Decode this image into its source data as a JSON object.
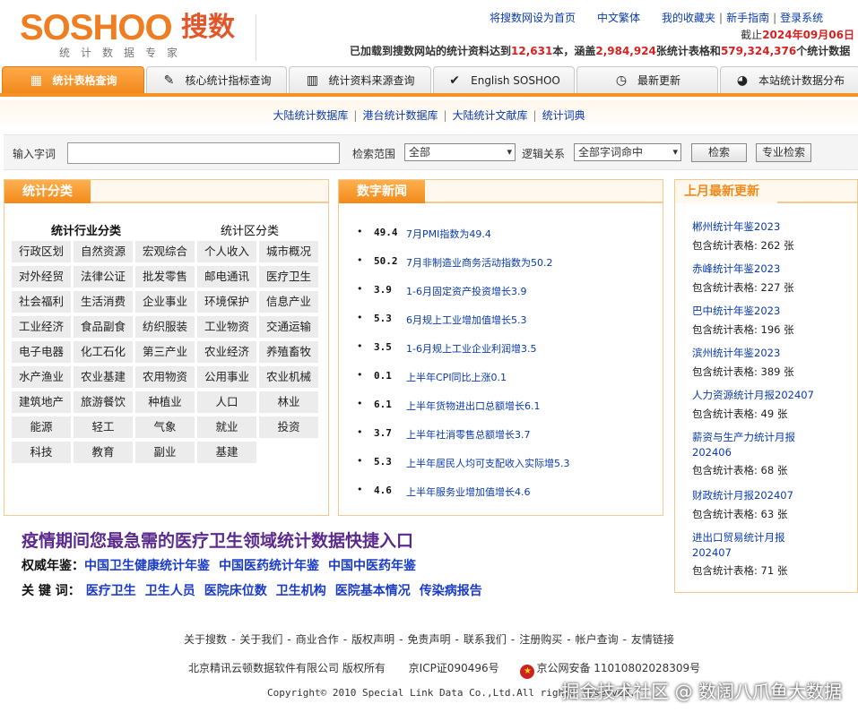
{
  "logo": {
    "brand": "SOSHOO",
    "brand_cn": "搜数",
    "tagline": "统计数据专家"
  },
  "toplinks": [
    "将搜数网设为首页",
    "中文繁体",
    "我的收藏夹",
    "新手指南",
    "登录系统"
  ],
  "date": {
    "prefix": "截止",
    "value": "2024年09月06日"
  },
  "stats": {
    "p1": "已加载到搜数网站的统计资料达到",
    "books": "12,631",
    "p2": "本，涵盖",
    "tables": "2,984,924",
    "p3": "张统计表格和",
    "items": "579,324,376",
    "p4": "个统计数据"
  },
  "tabs": [
    {
      "label": "统计表格查询",
      "icon": "table-icon",
      "glyph": "▦"
    },
    {
      "label": "核心统计指标查询",
      "icon": "document-icon",
      "glyph": "✎"
    },
    {
      "label": "统计资料来源查询",
      "icon": "bar-chart-icon",
      "glyph": "▥"
    },
    {
      "label": "English SOSHOO",
      "icon": "checkmark-icon",
      "glyph": "✔"
    },
    {
      "label": "最新更新",
      "icon": "clock-icon",
      "glyph": "◷"
    },
    {
      "label": "本站统计数据分布",
      "icon": "pie-chart-icon",
      "glyph": "◕"
    }
  ],
  "subnav": [
    "大陆统计数据库",
    "港台统计数据库",
    "大陆统计文献库",
    "统计词典"
  ],
  "search": {
    "keyword_label": "输入字词",
    "scope_label": "检索范围",
    "scope_value": "全部",
    "logic_label": "逻辑关系",
    "logic_value": "全部字词命中",
    "search_button": "检索",
    "advanced_button": "专业检索"
  },
  "categories": {
    "title": "统计分类",
    "industry_head": "统计行业分类",
    "region_head": "统计区分类",
    "cells": [
      "行政区划",
      "自然资源",
      "宏观综合",
      "个人收入",
      "城市概况",
      "对外经贸",
      "法律公证",
      "批发零售",
      "邮电通讯",
      "医疗卫生",
      "社会福利",
      "生活消费",
      "企业事业",
      "环境保护",
      "信息产业",
      "工业经济",
      "食品副食",
      "纺织服装",
      "工业物资",
      "交通运输",
      "电子电器",
      "化工石化",
      "第三产业",
      "农业经济",
      "养殖畜牧",
      "水产渔业",
      "农业基建",
      "农用物资",
      "公用事业",
      "农业机械",
      "建筑地产",
      "旅游餐饮",
      "种植业",
      "人口",
      "林业",
      "能源",
      "轻工",
      "气象",
      "就业",
      "投资",
      "科技",
      "教育",
      "副业",
      "基建"
    ]
  },
  "news": {
    "title": "数字新闻",
    "items": [
      {
        "num": "49.4",
        "text": "7月PMI指数为49.4"
      },
      {
        "num": "50.2",
        "text": "7月非制造业商务活动指数为50.2"
      },
      {
        "num": "3.9",
        "text": "1-6月固定资产投资增长3.9"
      },
      {
        "num": "5.3",
        "text": "6月规上工业增加值增长5.3"
      },
      {
        "num": "3.5",
        "text": "1-6月规上工业企业利润增3.5"
      },
      {
        "num": "0.1",
        "text": "上半年CPI同比上涨0.1"
      },
      {
        "num": "6.1",
        "text": "上半年货物进出口总额增长6.1"
      },
      {
        "num": "3.7",
        "text": "上半年社消零售总额增长3.7"
      },
      {
        "num": "5.3",
        "text": "上半年居民人均可支配收入实际增5.3"
      },
      {
        "num": "4.6",
        "text": "上半年服务业增加值增长4.6"
      }
    ]
  },
  "last_month": {
    "title": "上月最新更新",
    "items": [
      {
        "title": "郴州统计年鉴2023",
        "title2": "",
        "count": "包含统计表格: 262 张"
      },
      {
        "title": "赤峰统计年鉴2023",
        "title2": "",
        "count": "包含统计表格: 227 张"
      },
      {
        "title": "巴中统计年鉴2023",
        "title2": "",
        "count": "包含统计表格: 196 张"
      },
      {
        "title": "滨州统计年鉴2023",
        "title2": "",
        "count": "包含统计表格: 389 张"
      },
      {
        "title": "人力资源统计月报202407",
        "title2": "",
        "count": "包含统计表格: 49 张"
      },
      {
        "title": "薪资与生产力统计月报",
        "title2": "202406",
        "count": "包含统计表格: 68 张"
      },
      {
        "title": "财政统计月报202407",
        "title2": "",
        "count": "包含统计表格: 63 张"
      },
      {
        "title": "进出口贸易统计月报",
        "title2": "202407",
        "count": "包含统计表格: 71 张"
      }
    ]
  },
  "covid": {
    "title": "疫情期间您最急需的医疗卫生领域统计数据快捷入口",
    "yearbook_label": "权威年鉴：",
    "yearbooks": [
      "中国卫生健康统计年鉴",
      "中国医药统计年鉴",
      "中国中医药年鉴"
    ],
    "keyword_label": "关 键 词：",
    "keywords": [
      "医疗卫生",
      "卫生人员",
      "医院床位数",
      "卫生机构",
      "医院基本情况",
      "传染病报告"
    ]
  },
  "footer": {
    "links": [
      "关于搜数",
      "关于我们",
      "商业合作",
      "版权声明",
      "免责声明",
      "联系我们",
      "注册购买",
      "帐户查询",
      "友情链接"
    ],
    "company": "北京精讯云顿数据软件有限公司  版权所有",
    "icp": "京ICP证090496号",
    "police": "京公网安备 11010802028309号",
    "copyright": "Copyright© 2010 Special Link Data Co.,Ltd.All rights reserved."
  },
  "watermark": "掘金技术社区 @ 数阔八爪鱼大数据",
  "colors": {
    "orange": "#f28a1a",
    "link_blue": "#0a3ba8",
    "red": "#d62222",
    "purple": "#5b2a8c"
  }
}
